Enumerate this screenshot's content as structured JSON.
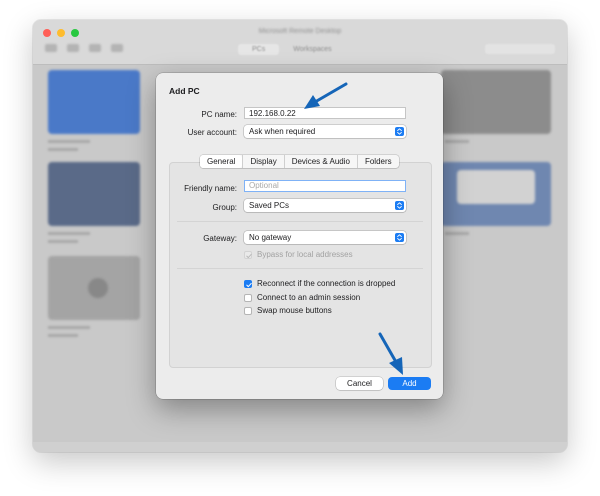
{
  "background_window": {
    "title": "Microsoft Remote Desktop",
    "segments": [
      "PCs",
      "Workspaces"
    ]
  },
  "dialog": {
    "title": "Add PC",
    "pc_name": {
      "label": "PC name:",
      "value": "192.168.0.22"
    },
    "user_account": {
      "label": "User account:",
      "value": "Ask when required"
    },
    "tabs": [
      {
        "label": "General",
        "active": true
      },
      {
        "label": "Display",
        "active": false
      },
      {
        "label": "Devices & Audio",
        "active": false
      },
      {
        "label": "Folders",
        "active": false
      }
    ],
    "friendly_name": {
      "label": "Friendly name:",
      "value": "",
      "placeholder": "Optional"
    },
    "group": {
      "label": "Group:",
      "value": "Saved PCs"
    },
    "gateway": {
      "label": "Gateway:",
      "value": "No gateway"
    },
    "bypass": {
      "label": "Bypass for local addresses",
      "checked": true,
      "enabled": false
    },
    "options": [
      {
        "label": "Reconnect if the connection is dropped",
        "checked": true
      },
      {
        "label": "Connect to an admin session",
        "checked": false
      },
      {
        "label": "Swap mouse buttons",
        "checked": false
      }
    ],
    "cancel_label": "Cancel",
    "add_label": "Add"
  },
  "colors": {
    "accent": "#1b7cf3",
    "annotation_arrow": "#1565b8",
    "close_light": "#ff5f57",
    "min_light": "#febc2e",
    "max_light": "#28c840"
  },
  "icons": {
    "checkbox": "checkmark-icon",
    "popup": "chevron-up-down-icon",
    "annotation": "arrow-annotation-icon"
  }
}
